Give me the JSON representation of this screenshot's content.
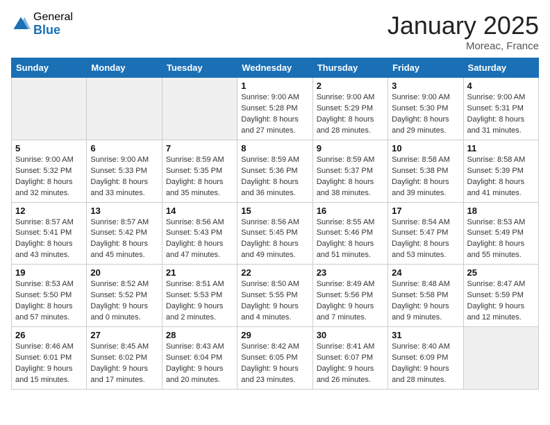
{
  "header": {
    "logo_general": "General",
    "logo_blue": "Blue",
    "month_title": "January 2025",
    "location": "Moreac, France"
  },
  "weekdays": [
    "Sunday",
    "Monday",
    "Tuesday",
    "Wednesday",
    "Thursday",
    "Friday",
    "Saturday"
  ],
  "weeks": [
    [
      {
        "day": "",
        "info": ""
      },
      {
        "day": "",
        "info": ""
      },
      {
        "day": "",
        "info": ""
      },
      {
        "day": "1",
        "info": "Sunrise: 9:00 AM\nSunset: 5:28 PM\nDaylight: 8 hours and 27 minutes."
      },
      {
        "day": "2",
        "info": "Sunrise: 9:00 AM\nSunset: 5:29 PM\nDaylight: 8 hours and 28 minutes."
      },
      {
        "day": "3",
        "info": "Sunrise: 9:00 AM\nSunset: 5:30 PM\nDaylight: 8 hours and 29 minutes."
      },
      {
        "day": "4",
        "info": "Sunrise: 9:00 AM\nSunset: 5:31 PM\nDaylight: 8 hours and 31 minutes."
      }
    ],
    [
      {
        "day": "5",
        "info": "Sunrise: 9:00 AM\nSunset: 5:32 PM\nDaylight: 8 hours and 32 minutes."
      },
      {
        "day": "6",
        "info": "Sunrise: 9:00 AM\nSunset: 5:33 PM\nDaylight: 8 hours and 33 minutes."
      },
      {
        "day": "7",
        "info": "Sunrise: 8:59 AM\nSunset: 5:35 PM\nDaylight: 8 hours and 35 minutes."
      },
      {
        "day": "8",
        "info": "Sunrise: 8:59 AM\nSunset: 5:36 PM\nDaylight: 8 hours and 36 minutes."
      },
      {
        "day": "9",
        "info": "Sunrise: 8:59 AM\nSunset: 5:37 PM\nDaylight: 8 hours and 38 minutes."
      },
      {
        "day": "10",
        "info": "Sunrise: 8:58 AM\nSunset: 5:38 PM\nDaylight: 8 hours and 39 minutes."
      },
      {
        "day": "11",
        "info": "Sunrise: 8:58 AM\nSunset: 5:39 PM\nDaylight: 8 hours and 41 minutes."
      }
    ],
    [
      {
        "day": "12",
        "info": "Sunrise: 8:57 AM\nSunset: 5:41 PM\nDaylight: 8 hours and 43 minutes."
      },
      {
        "day": "13",
        "info": "Sunrise: 8:57 AM\nSunset: 5:42 PM\nDaylight: 8 hours and 45 minutes."
      },
      {
        "day": "14",
        "info": "Sunrise: 8:56 AM\nSunset: 5:43 PM\nDaylight: 8 hours and 47 minutes."
      },
      {
        "day": "15",
        "info": "Sunrise: 8:56 AM\nSunset: 5:45 PM\nDaylight: 8 hours and 49 minutes."
      },
      {
        "day": "16",
        "info": "Sunrise: 8:55 AM\nSunset: 5:46 PM\nDaylight: 8 hours and 51 minutes."
      },
      {
        "day": "17",
        "info": "Sunrise: 8:54 AM\nSunset: 5:47 PM\nDaylight: 8 hours and 53 minutes."
      },
      {
        "day": "18",
        "info": "Sunrise: 8:53 AM\nSunset: 5:49 PM\nDaylight: 8 hours and 55 minutes."
      }
    ],
    [
      {
        "day": "19",
        "info": "Sunrise: 8:53 AM\nSunset: 5:50 PM\nDaylight: 8 hours and 57 minutes."
      },
      {
        "day": "20",
        "info": "Sunrise: 8:52 AM\nSunset: 5:52 PM\nDaylight: 9 hours and 0 minutes."
      },
      {
        "day": "21",
        "info": "Sunrise: 8:51 AM\nSunset: 5:53 PM\nDaylight: 9 hours and 2 minutes."
      },
      {
        "day": "22",
        "info": "Sunrise: 8:50 AM\nSunset: 5:55 PM\nDaylight: 9 hours and 4 minutes."
      },
      {
        "day": "23",
        "info": "Sunrise: 8:49 AM\nSunset: 5:56 PM\nDaylight: 9 hours and 7 minutes."
      },
      {
        "day": "24",
        "info": "Sunrise: 8:48 AM\nSunset: 5:58 PM\nDaylight: 9 hours and 9 minutes."
      },
      {
        "day": "25",
        "info": "Sunrise: 8:47 AM\nSunset: 5:59 PM\nDaylight: 9 hours and 12 minutes."
      }
    ],
    [
      {
        "day": "26",
        "info": "Sunrise: 8:46 AM\nSunset: 6:01 PM\nDaylight: 9 hours and 15 minutes."
      },
      {
        "day": "27",
        "info": "Sunrise: 8:45 AM\nSunset: 6:02 PM\nDaylight: 9 hours and 17 minutes."
      },
      {
        "day": "28",
        "info": "Sunrise: 8:43 AM\nSunset: 6:04 PM\nDaylight: 9 hours and 20 minutes."
      },
      {
        "day": "29",
        "info": "Sunrise: 8:42 AM\nSunset: 6:05 PM\nDaylight: 9 hours and 23 minutes."
      },
      {
        "day": "30",
        "info": "Sunrise: 8:41 AM\nSunset: 6:07 PM\nDaylight: 9 hours and 26 minutes."
      },
      {
        "day": "31",
        "info": "Sunrise: 8:40 AM\nSunset: 6:09 PM\nDaylight: 9 hours and 28 minutes."
      },
      {
        "day": "",
        "info": ""
      }
    ]
  ]
}
